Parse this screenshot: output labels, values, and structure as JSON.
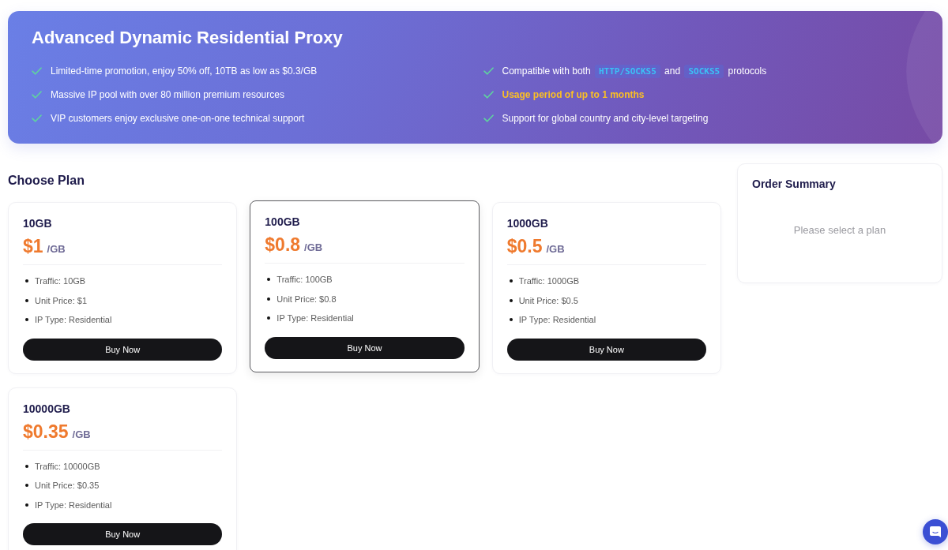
{
  "banner": {
    "title": "Advanced Dynamic Residential Proxy",
    "features": [
      {
        "segments": [
          {
            "kind": "text",
            "text": "Limited-time promotion, enjoy 50% off, 10TB as low as $0.3/GB"
          }
        ],
        "highlighted": false
      },
      {
        "segments": [
          {
            "kind": "text",
            "text": "Massive IP pool with over 80 million premium resources"
          }
        ],
        "highlighted": false
      },
      {
        "segments": [
          {
            "kind": "text",
            "text": "VIP customers enjoy exclusive one-on-one technical support"
          }
        ],
        "highlighted": false
      },
      {
        "segments": [
          {
            "kind": "text",
            "text": "Compatible with both "
          },
          {
            "kind": "code",
            "text": "HTTP/SOCKS5"
          },
          {
            "kind": "text",
            "text": " and "
          },
          {
            "kind": "code",
            "text": "SOCKS5"
          },
          {
            "kind": "text",
            "text": " protocols"
          }
        ],
        "highlighted": false
      },
      {
        "segments": [
          {
            "kind": "text",
            "text": "Usage period of up to 1 months"
          }
        ],
        "highlighted": true
      },
      {
        "segments": [
          {
            "kind": "text",
            "text": "Support for global country and city-level targeting"
          }
        ],
        "highlighted": false
      }
    ]
  },
  "plan_section": {
    "heading": "Choose Plan"
  },
  "plans": [
    {
      "name": "10GB",
      "price": "$1",
      "unit": "/GB",
      "details": [
        "Traffic: 10GB",
        "Unit Price: $1",
        "IP Type: Residential"
      ],
      "button": "Buy Now",
      "selected": false
    },
    {
      "name": "100GB",
      "price": "$0.8",
      "unit": "/GB",
      "details": [
        "Traffic: 100GB",
        "Unit Price: $0.8",
        "IP Type: Residential"
      ],
      "button": "Buy Now",
      "selected": true
    },
    {
      "name": "1000GB",
      "price": "$0.5",
      "unit": "/GB",
      "details": [
        "Traffic: 1000GB",
        "Unit Price: $0.5",
        "IP Type: Residential"
      ],
      "button": "Buy Now",
      "selected": false
    },
    {
      "name": "10000GB",
      "price": "$0.35",
      "unit": "/GB",
      "details": [
        "Traffic: 10000GB",
        "Unit Price: $0.35",
        "IP Type: Residential"
      ],
      "button": "Buy Now",
      "selected": false
    }
  ],
  "order_summary": {
    "title": "Order Summary",
    "message": "Please select a plan"
  }
}
